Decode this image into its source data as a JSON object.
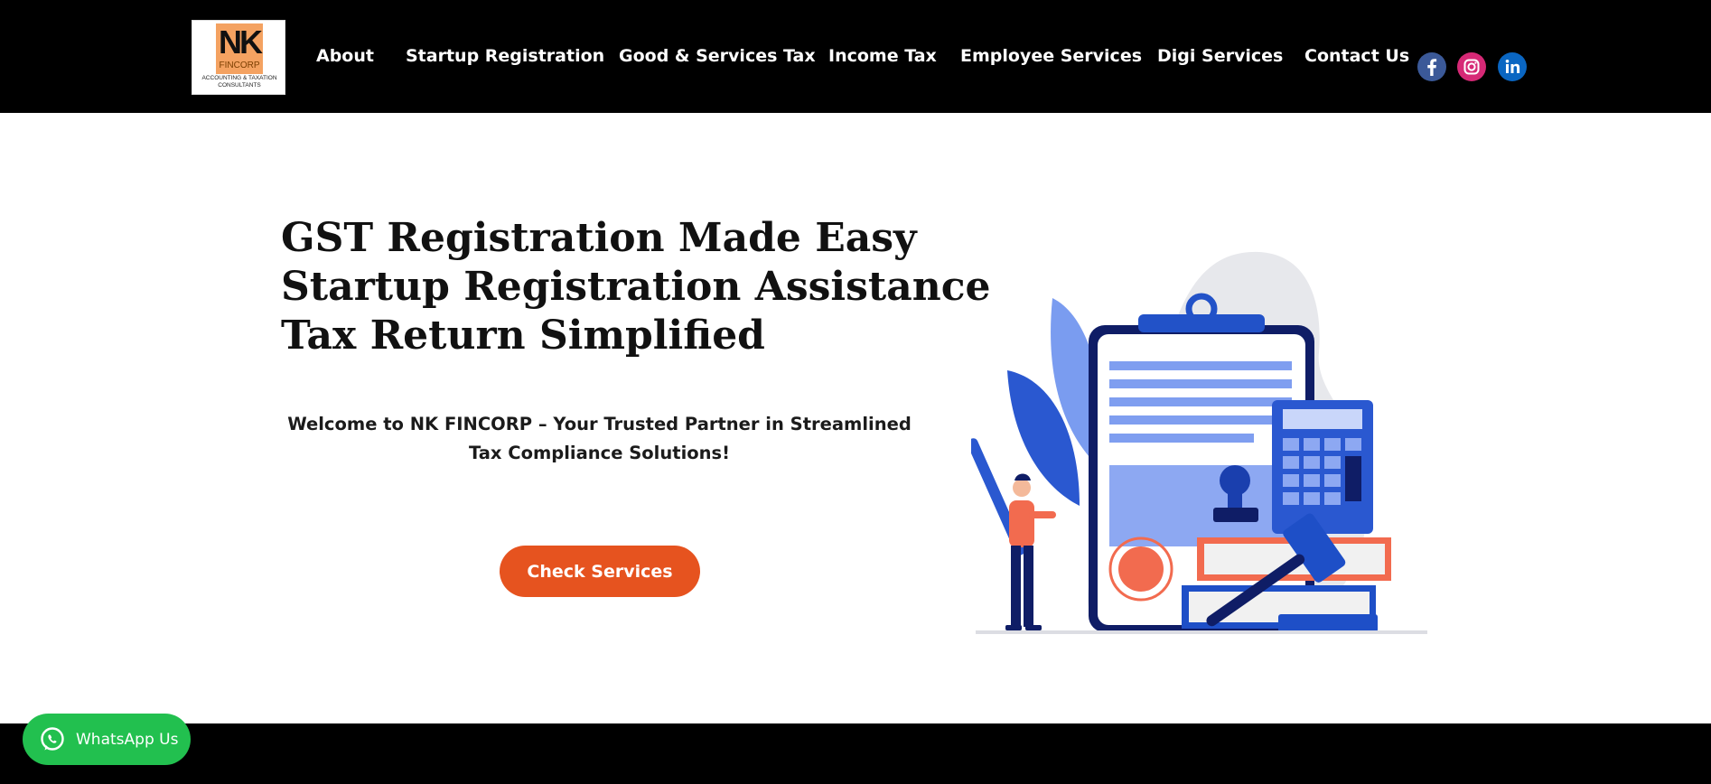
{
  "header": {
    "logo": {
      "letters": "NK",
      "wordmark": "FINCORP",
      "tagline": "ACCOUNTING & TAXATION CONSULTANTS"
    },
    "nav": [
      {
        "label": "About"
      },
      {
        "label": "Startup Registration"
      },
      {
        "label": "Good & Services Tax"
      },
      {
        "label": "Income Tax"
      },
      {
        "label": "Employee Services"
      },
      {
        "label": "Digi Services"
      },
      {
        "label": "Contact Us"
      }
    ],
    "social": [
      {
        "name": "facebook",
        "color": "#3b5998"
      },
      {
        "name": "instagram",
        "color": "#d62976"
      },
      {
        "name": "linkedin",
        "color": "#0a66c2"
      }
    ]
  },
  "hero": {
    "title_lines": [
      "GST Registration Made Easy",
      "Startup Registration Assistance",
      "Tax Return Simplified"
    ],
    "welcome": "Welcome to NK FINCORP – Your Trusted Partner in Streamlined Tax Compliance Solutions!",
    "cta_label": "Check Services"
  },
  "floating": {
    "whatsapp_label": "WhatsApp Us"
  },
  "colors": {
    "header_bg": "#000000",
    "cta": "#e6531f",
    "whatsapp": "#22c04f",
    "illustration_blue": "#1e4fc7",
    "illustration_orange": "#f26b4f"
  }
}
